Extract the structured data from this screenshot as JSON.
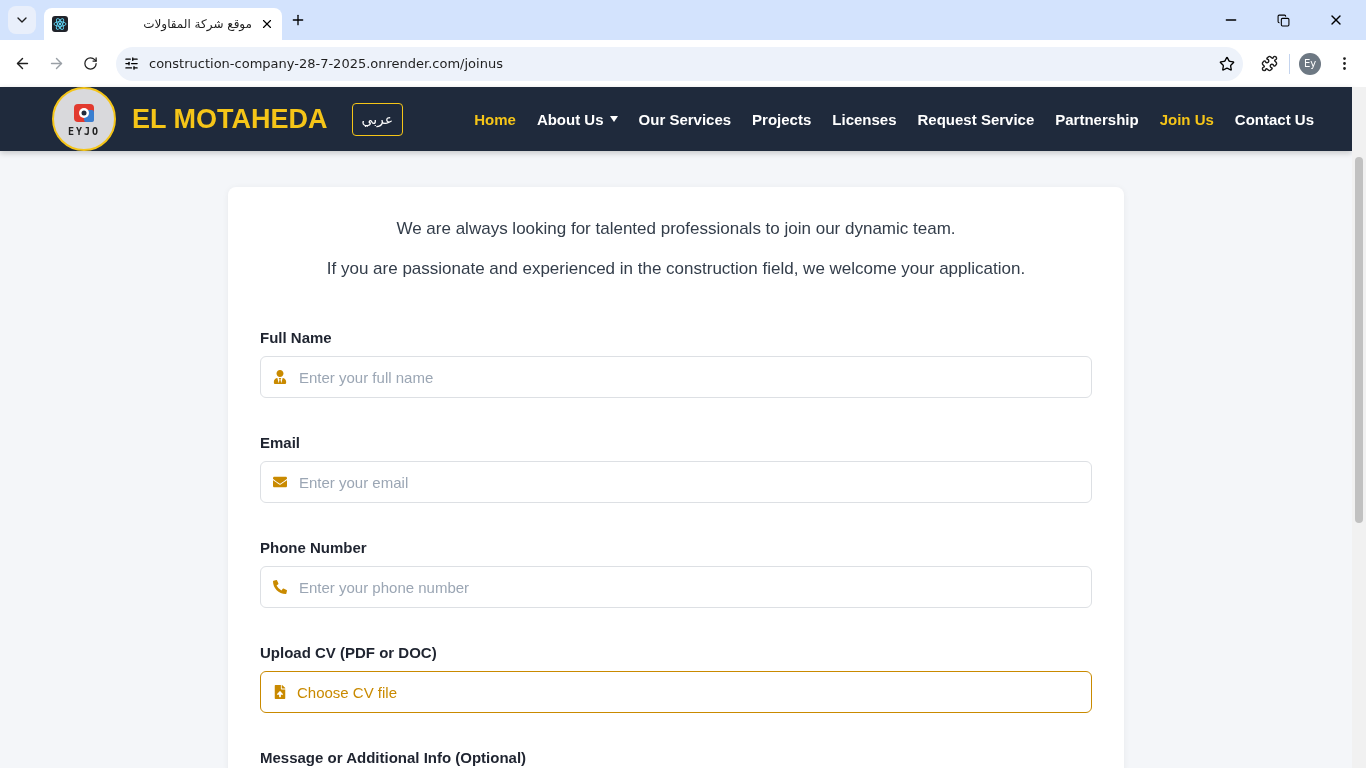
{
  "browser": {
    "tab_title": "موقع شركة المقاولات",
    "url": "construction-company-28-7-2025.onrender.com/joinus",
    "profile": "Ey"
  },
  "header": {
    "logo_text": "EYJO",
    "brand": "EL MOTAHEDA",
    "language_button": "عربي",
    "nav": [
      {
        "label": "Home",
        "selected": true,
        "has_menu": false
      },
      {
        "label": "About Us",
        "selected": false,
        "has_menu": true
      },
      {
        "label": "Our Services",
        "selected": false,
        "has_menu": false
      },
      {
        "label": "Projects",
        "selected": false,
        "has_menu": false
      },
      {
        "label": "Licenses",
        "selected": false,
        "has_menu": false
      },
      {
        "label": "Request Service",
        "selected": false,
        "has_menu": false
      },
      {
        "label": "Partnership",
        "selected": false,
        "has_menu": false
      },
      {
        "label": "Join Us",
        "selected": true,
        "has_menu": false
      },
      {
        "label": "Contact Us",
        "selected": false,
        "has_menu": false
      }
    ]
  },
  "intro": [
    "We are always looking for talented professionals to join our dynamic team.",
    "If you are passionate and experienced in the construction field, we welcome your application."
  ],
  "form": {
    "fields": [
      {
        "kind": "name",
        "label": "Full Name",
        "placeholder": "Enter your full name"
      },
      {
        "kind": "email",
        "label": "Email",
        "placeholder": "Enter your email"
      },
      {
        "kind": "phone",
        "label": "Phone Number",
        "placeholder": "Enter your phone number"
      },
      {
        "kind": "file",
        "label": "Upload CV (PDF or DOC)",
        "button": "Choose CV file"
      },
      {
        "kind": "message",
        "label": "Message or Additional Info (Optional)"
      }
    ]
  }
}
